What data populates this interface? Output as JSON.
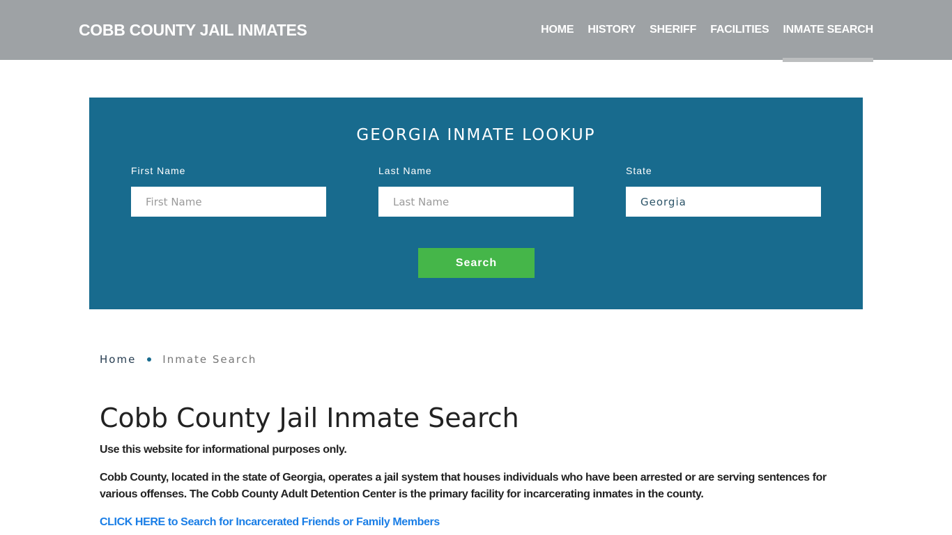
{
  "header": {
    "brand": "COBB COUNTY JAIL INMATES",
    "nav": [
      {
        "label": "HOME",
        "active": false
      },
      {
        "label": "HISTORY",
        "active": false
      },
      {
        "label": "SHERIFF",
        "active": false
      },
      {
        "label": "FACILITIES",
        "active": false
      },
      {
        "label": "INMATE SEARCH",
        "active": true
      }
    ]
  },
  "lookup": {
    "title": "GEORGIA INMATE LOOKUP",
    "first_name": {
      "label": "First Name",
      "placeholder": "First Name",
      "value": ""
    },
    "last_name": {
      "label": "Last Name",
      "placeholder": "Last Name",
      "value": ""
    },
    "state": {
      "label": "State",
      "value": "Georgia"
    },
    "search_label": "Search",
    "colors": {
      "panel": "#186b8e",
      "button": "#45b649"
    }
  },
  "breadcrumb": {
    "home": "Home",
    "current": "Inmate Search"
  },
  "main": {
    "title": "Cobb County Jail Inmate Search",
    "disclaimer": "Use this website for informational purposes only.",
    "intro": "Cobb County, located in the state of Georgia, operates a jail system that houses individuals who have been arrested or are serving sentences for various offenses. The Cobb County Adult Detention Center is the primary facility for incarcerating inmates in the county.",
    "cta": "CLICK HERE to Search for Incarcerated Friends or Family Members"
  }
}
